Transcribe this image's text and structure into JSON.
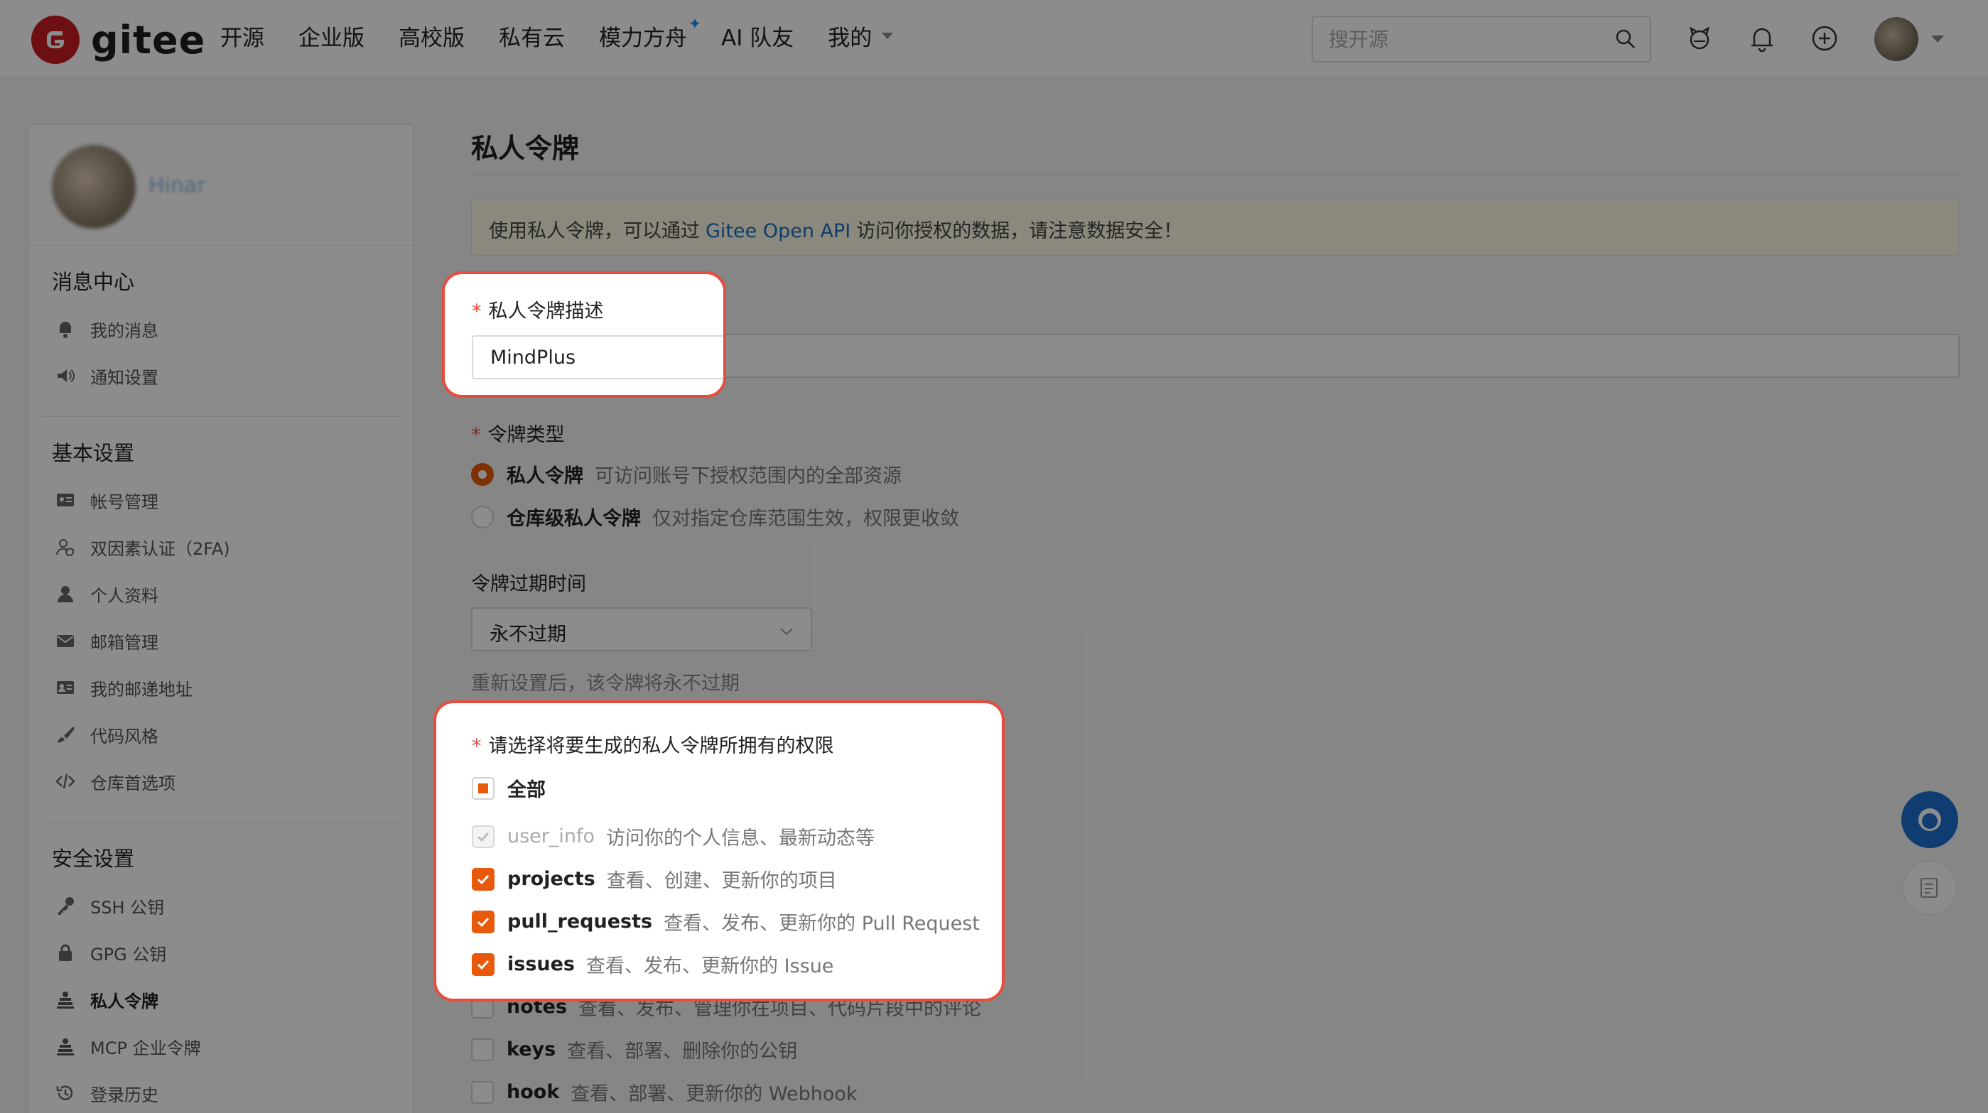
{
  "header": {
    "logo_text": "gitee",
    "nav": [
      {
        "label": "开源",
        "caret": false,
        "star": false
      },
      {
        "label": "企业版",
        "caret": false,
        "star": false
      },
      {
        "label": "高校版",
        "caret": false,
        "star": false
      },
      {
        "label": "私有云",
        "caret": false,
        "star": false
      },
      {
        "label": "模力方舟",
        "caret": false,
        "star": true
      },
      {
        "label": "AI 队友",
        "caret": false,
        "star": false
      },
      {
        "label": "我的",
        "caret": true,
        "star": false
      }
    ],
    "search_placeholder": "搜开源"
  },
  "sidebar": {
    "username": "Hinar",
    "sections": [
      {
        "title": "消息中心",
        "items": [
          {
            "label": "我的消息",
            "icon": "bell-icon",
            "active": false
          },
          {
            "label": "通知设置",
            "icon": "speaker-icon",
            "active": false
          }
        ]
      },
      {
        "title": "基本设置",
        "items": [
          {
            "label": "帐号管理",
            "icon": "id-card-icon",
            "active": false
          },
          {
            "label": "双因素认证（2FA)",
            "icon": "user-shield-icon",
            "active": false
          },
          {
            "label": "个人资料",
            "icon": "user-icon",
            "active": false
          },
          {
            "label": "邮箱管理",
            "icon": "envelope-icon",
            "active": false
          },
          {
            "label": "我的邮递地址",
            "icon": "address-card-icon",
            "active": false
          },
          {
            "label": "代码风格",
            "icon": "brush-icon",
            "active": false
          },
          {
            "label": "仓库首选项",
            "icon": "code-icon",
            "active": false
          }
        ]
      },
      {
        "title": "安全设置",
        "items": [
          {
            "label": "SSH 公钥",
            "icon": "key-icon",
            "active": false
          },
          {
            "label": "GPG 公钥",
            "icon": "lock-icon",
            "active": false
          },
          {
            "label": "私人令牌",
            "icon": "token-icon",
            "active": true
          },
          {
            "label": "MCP 企业令牌",
            "icon": "token-icon",
            "active": false
          },
          {
            "label": "登录历史",
            "icon": "history-icon",
            "active": false
          }
        ]
      }
    ]
  },
  "main": {
    "title": "私人令牌",
    "notice": {
      "before": "使用私人令牌，可以通过",
      "link": "Gitee Open API",
      "after": "访问你授权的数据，请注意数据安全！"
    },
    "description_label": "私人令牌描述",
    "description_value": "MindPlus",
    "type_label": "令牌类型",
    "type_options": [
      {
        "name": "私人令牌",
        "desc": "可访问账号下授权范围内的全部资源",
        "checked": true
      },
      {
        "name": "仓库级私人令牌",
        "desc": "仅对指定仓库范围生效，权限更收敛",
        "checked": false
      }
    ],
    "expiry_label": "令牌过期时间",
    "expiry_value": "永不过期",
    "expiry_hint": "重新设置后，该令牌将永不过期",
    "scopes_label": "请选择将要生成的私人令牌所拥有的权限",
    "all_label": "全部",
    "scopes": [
      {
        "name": "user_info",
        "desc": "访问你的个人信息、最新动态等",
        "state": "disabled"
      },
      {
        "name": "projects",
        "desc": "查看、创建、更新你的项目",
        "state": "checked"
      },
      {
        "name": "pull_requests",
        "desc": "查看、发布、更新你的 Pull Request",
        "state": "checked"
      },
      {
        "name": "issues",
        "desc": "查看、发布、更新你的 Issue",
        "state": "checked"
      },
      {
        "name": "notes",
        "desc": "查看、发布、管理你在项目、代码片段中的评论",
        "state": "unchecked"
      },
      {
        "name": "keys",
        "desc": "查看、部署、删除你的公钥",
        "state": "unchecked"
      },
      {
        "name": "hook",
        "desc": "查看、部署、更新你的 Webhook",
        "state": "unchecked"
      }
    ]
  },
  "colors": {
    "brand_red": "#c71d23",
    "accent_orange": "#e8590c",
    "link_blue": "#1d6fc4",
    "highlight_border": "#e74c3c"
  }
}
